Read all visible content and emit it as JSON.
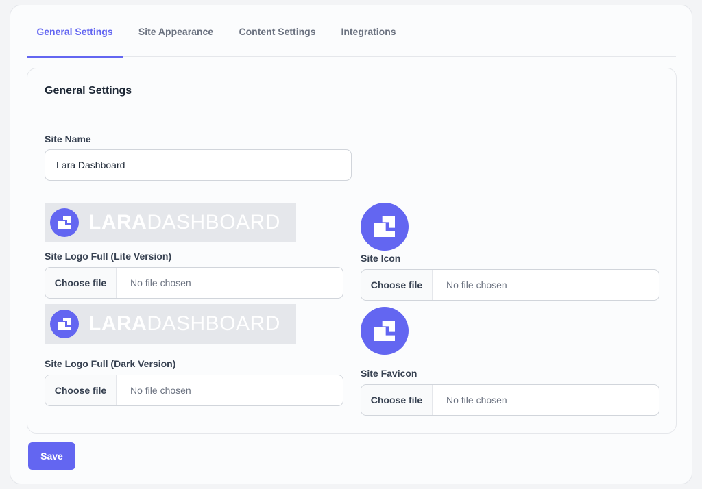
{
  "tabs": [
    {
      "label": "General Settings",
      "active": true
    },
    {
      "label": "Site Appearance",
      "active": false
    },
    {
      "label": "Content Settings",
      "active": false
    },
    {
      "label": "Integrations",
      "active": false
    }
  ],
  "card": {
    "title": "General Settings",
    "site_name": {
      "label": "Site Name",
      "value": "Lara Dashboard"
    },
    "logo_lite": {
      "label": "Site Logo Full (Lite Version)",
      "choose_label": "Choose file",
      "status": "No file chosen"
    },
    "logo_dark": {
      "label": "Site Logo Full (Dark Version)",
      "choose_label": "Choose file",
      "status": "No file chosen"
    },
    "site_icon": {
      "label": "Site Icon",
      "choose_label": "Choose file",
      "status": "No file chosen"
    },
    "site_favicon": {
      "label": "Site Favicon",
      "choose_label": "Choose file",
      "status": "No file chosen"
    },
    "brand": {
      "word1": "LARA",
      "word2": "DASHBOARD"
    }
  },
  "save_label": "Save",
  "colors": {
    "accent": "#6366f1",
    "logo_bg": "#e5e7eb",
    "text_muted": "#6b7280"
  }
}
